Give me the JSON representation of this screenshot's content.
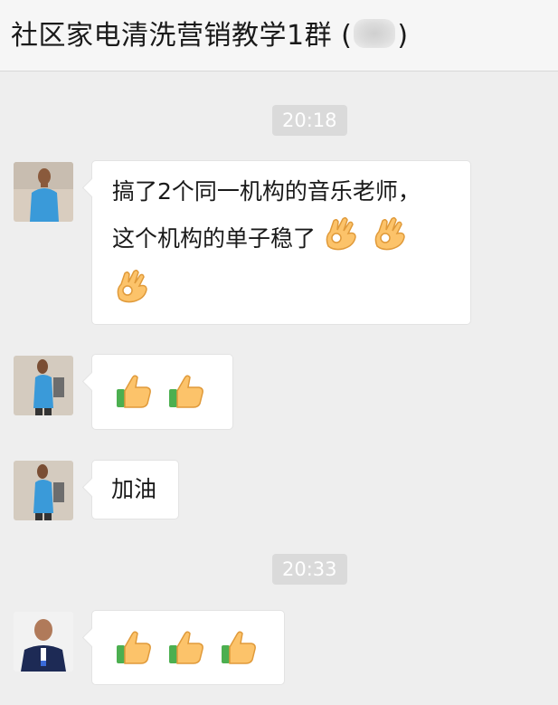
{
  "chat": {
    "title": "社区家电清洗营销教学1群 (",
    "title_close": ")"
  },
  "messages": [
    {
      "type": "time",
      "text": "20:18"
    },
    {
      "type": "text",
      "lines": [
        "搞了2个同一机构的音乐老师，",
        "这个机构的单子稳了"
      ],
      "emoji": [
        "ok-hand",
        "ok-hand",
        "ok-hand"
      ]
    },
    {
      "type": "emoji",
      "emoji": [
        "thumbs-up",
        "thumbs-up"
      ]
    },
    {
      "type": "text",
      "text": "加油"
    },
    {
      "type": "time",
      "text": "20:33"
    },
    {
      "type": "emoji",
      "emoji": [
        "thumbs-up",
        "thumbs-up",
        "thumbs-up"
      ]
    }
  ],
  "colors": {
    "background": "#eeeeee",
    "header": "#f6f6f6",
    "bubble": "#ffffff",
    "timestamp_bg": "#dadada",
    "avatar_shirt_blue": "#3a9ad9",
    "avatar_navy": "#1d2a55"
  }
}
